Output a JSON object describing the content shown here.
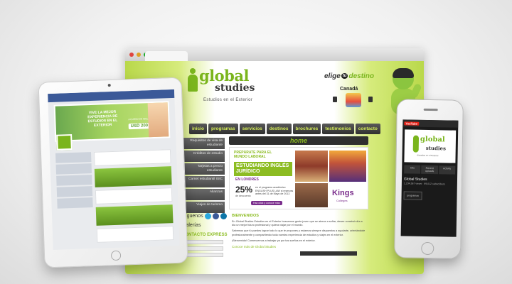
{
  "browser": {
    "logo_word1": "global",
    "logo_word2": "studies",
    "tagline": "Estudios en el Exterior",
    "elige": "elige",
    "tu": "tu",
    "destino": "destino",
    "country": "Canadá",
    "nav": [
      "inicio",
      "programas",
      "servicios",
      "destinos",
      "brochures",
      "testimonios",
      "contacto"
    ],
    "sidebar": [
      "Requisitos de visa de estudiante",
      "Créditos de estudio",
      "Tarjetas a precio estudiante",
      "Carnet estudiantil ISIC",
      "Alianzas",
      "Viajes de turismo"
    ],
    "social_label": "Síguenos",
    "galleries_label": "Galerías",
    "contact_label": "CONTACTO EXPRESS",
    "home_title": "home",
    "banner": {
      "prep": "PREPÁRATE PARA EL MUNDO LABORAL",
      "ingles": "ESTUDIANDO INGLÉS JURÍDICO",
      "londres": "EN LONDRES",
      "pct": "25%",
      "pct_desc": "de descuento",
      "promo": "en el programa académico ENGLISH PLUS LAW si reservas antes del 31 de Mayo de 2013",
      "button": "Haz click y conoce más",
      "kings": "Kings",
      "colleges": "Colleges"
    },
    "welcome": "BIENVENIDOS",
    "para1": "En Global Studies Estudios en el Exterior buscamos gente joven que se atreva a soñar, desee construir día a día un mejor futuro profesional y quiera viajar por el mundo.",
    "para2": "Sabemos que tú puedes lograr todo lo que te propones y estamos siempre dispuestos a ayudarte, orientándote profesionalmente y compartiendo toda nuestra experiencia de estudios y viajes en el exterior.",
    "para3": "¡Bienvenido! Comencemos a trabajar ya por tus sueños en el exterior.",
    "more_link": "Conoce más de Global Studies"
  },
  "tablet": {
    "headline": "VIVE LA MEJOR EXPERIENCIA DE ESTUDIOS EN EL EXTERIOR",
    "price_label": "A CURSO DE INGLÉS POR",
    "price": "USD 200"
  },
  "phone": {
    "yt": "YouTube",
    "logo_word1": "global",
    "logo_word2": "studies",
    "tagline": "Estudios en el Exterior",
    "tabs": [
      "Info",
      "Recent uploads",
      "Activity"
    ],
    "title": "Global Studies",
    "subtitle": "1,234,567 views · 89,012 subscribers",
    "brand_mark": "programas"
  },
  "colors": {
    "brand_green": "#8cbc22",
    "dark_nav": "#2f2f2f",
    "accent_purple": "#7a2d8c",
    "facebook_blue": "#3b5998"
  }
}
